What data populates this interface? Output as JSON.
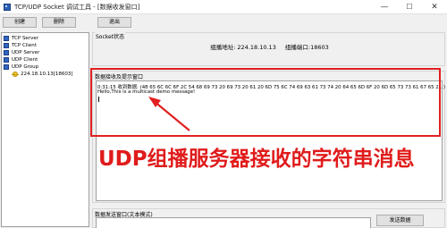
{
  "window": {
    "title": "TCP/UDP Socket 调试工具 - [数据收发窗口]",
    "minimize": "—",
    "maximize": "☐",
    "close": "✕"
  },
  "toolbar": {
    "create_label": "创建",
    "delete_label": "删除",
    "exit_label": "退出"
  },
  "tree": {
    "items": [
      {
        "label": "TCP Server",
        "icon": "server-icon"
      },
      {
        "label": "TCP Client",
        "icon": "client-icon"
      },
      {
        "label": "UDP Server",
        "icon": "server-icon"
      },
      {
        "label": "UDP Client",
        "icon": "client-icon"
      },
      {
        "label": "UDP Group",
        "icon": "group-icon"
      }
    ],
    "child": {
      "label": "224.18.10.13[18603]",
      "icon": "connection-icon"
    }
  },
  "status": {
    "group_title": "Socket状态",
    "addr_label": "组播地址:",
    "addr_value": "224.18.10.13",
    "port_label": "组播端口:",
    "port_value": "18603"
  },
  "receive": {
    "group_title": "数据接收及提示窗口",
    "line1": "0:31:15 收到数据: (48 65 6C 6C 6F 2C 54 68 69 73 20 69 73 20 61 20 6D 75 6C 74 69 63 61 73 74 20 64 65 6D 6F 20 6D 65 73 73 61 67 65 21 )",
    "line2": "Hello,This is a multicast demo message!"
  },
  "annotation": {
    "text": "UDP组播服务器接收的字符串消息"
  },
  "send": {
    "group_title": "数据发送窗口(文本模式)",
    "button_label": "发送数据"
  },
  "colors": {
    "highlight": "#e02020",
    "annotation": "#e01b1b",
    "tree_icon": "#2f66c5"
  }
}
